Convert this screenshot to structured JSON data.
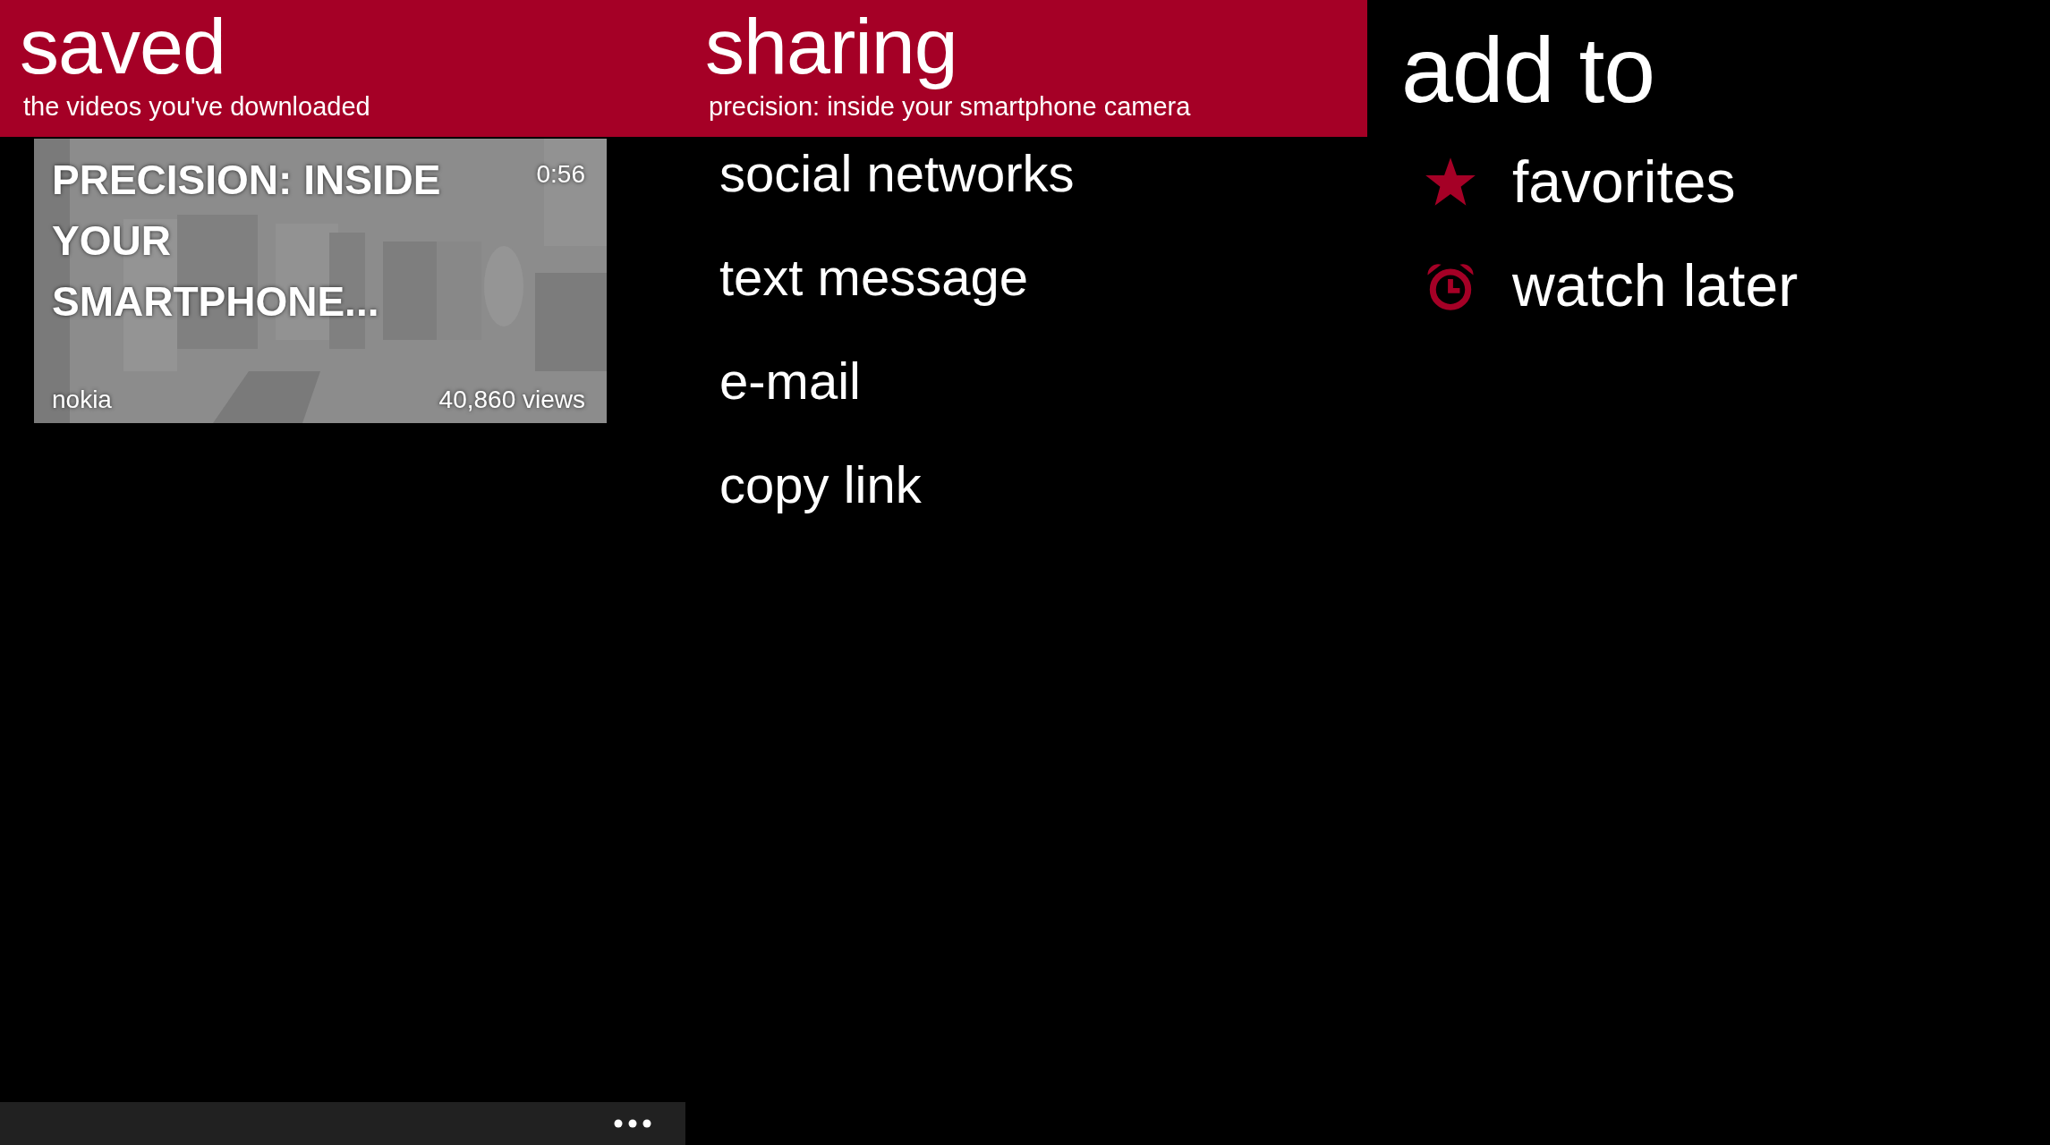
{
  "saved": {
    "title": "saved",
    "subtitle": "the videos you've downloaded",
    "videos": [
      {
        "kind": "picture",
        "title": "PRECISION: INSIDE YOUR SMARTPHONE...",
        "duration": "0:56",
        "channel": "nokia",
        "views": "40,860 views"
      }
    ],
    "app_bar": {
      "more": true
    }
  },
  "sharing": {
    "title": "sharing",
    "subtitle": "precision: inside your smartphone camera",
    "items": [
      "social networks",
      "text message",
      "e-mail",
      "copy link"
    ]
  },
  "add_to": {
    "title": "add to",
    "items": [
      {
        "kind": "star",
        "label": "favorites"
      },
      {
        "kind": "alarm",
        "label": "watch later"
      }
    ]
  }
}
